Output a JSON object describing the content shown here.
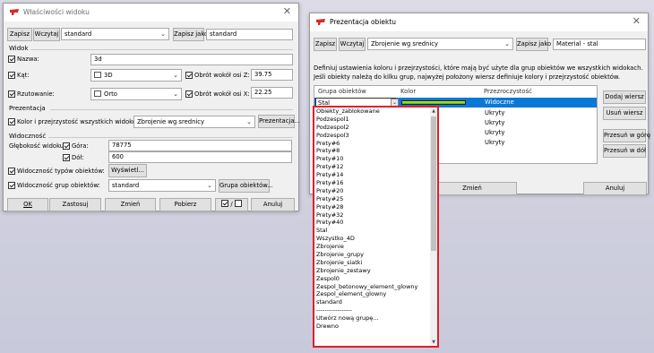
{
  "colors": {
    "brand_red": "#d42a2a",
    "selection": "#0a78d7",
    "highlight_border": "#e0202a"
  },
  "win1": {
    "title": "Właściwości widoku",
    "save_label": "Zapisz",
    "load_label": "Wczytaj",
    "preset_value": "standard",
    "save_as_label": "Zapisz jako",
    "save_as_value": "standard",
    "view_section": "Widok",
    "name_label": "Nazwa:",
    "name_value": "3d",
    "angle_label": "Kąt:",
    "angle_value": "3D",
    "rot_z_label": "Obrót wokół osi Z:",
    "rot_z_value": "39.75",
    "projection_label": "Rzutowanie:",
    "projection_value": "Orto",
    "rot_x_label": "Obrót wokół osi X:",
    "rot_x_value": "22.25",
    "presentation_section": "Prezentacja",
    "color_all_label": "Kolor i przejrzystość wszystkich widoków:",
    "color_all_value": "Zbrojenie wg srednicy",
    "presentation_button": "Prezentacja...",
    "visibility_section": "Widoczność",
    "depth_label": "Głębokość widoku:",
    "top_label": "Góra:",
    "top_value": "78775",
    "bottom_label": "Dół:",
    "bottom_value": "600",
    "type_vis_label": "Widoczność typów obiektów:",
    "show_button": "Wyświetl...",
    "group_vis_label": "Widoczność grup obiektów:",
    "group_vis_value": "standard",
    "group_button": "Grupa obiektów...",
    "ok": "OK",
    "apply": "Zastosuj",
    "modify": "Zmień",
    "get": "Pobierz",
    "toggle": "/",
    "cancel": "Anuluj"
  },
  "win2": {
    "title": "Prezentacja obiektu",
    "save_label": "Zapisz",
    "load_label": "Wczytaj",
    "preset_value": "Zbrojenie wg srednicy",
    "save_as_label": "Zapisz jako",
    "save_as_value": "Material - stal",
    "info_line1": "Definiuj ustawienia koloru i przejrzystości, które mają być użyte dla grup obiektów we wszystkich widokach.",
    "info_line2": "Jeśli obiekty należą do kilku grup, najwyżej położony wiersz definiuje kolory i przejrzystość obiektów.",
    "col_group": "Grupa obiektów",
    "col_color": "Kolor",
    "col_transparency": "Przezroczystość",
    "rows": [
      {
        "group": "Stal",
        "transparency": "Widoczne"
      },
      {
        "group": "",
        "transparency": "Ukryty"
      },
      {
        "group": "",
        "transparency": "Ukryty"
      },
      {
        "group": "",
        "transparency": "Ukryty"
      },
      {
        "group": "",
        "transparency": "Ukryty"
      }
    ],
    "add_row": "Dodaj wiersz",
    "delete_row": "Usuń wiersz",
    "move_up": "Przesuń w górę",
    "move_down": "Przesuń w dół",
    "modify": "Zmień",
    "cancel": "Anuluj"
  },
  "dropdown_items": [
    "Obiekty_zablokowane",
    "Podzespol1",
    "Podzespol2",
    "Podzespol3",
    "Prety#6",
    "Prety#8",
    "Prety#10",
    "Prety#12",
    "Prety#14",
    "Prety#16",
    "Prety#20",
    "Prety#25",
    "Prety#28",
    "Prety#32",
    "Prety#40",
    "Stal",
    "Wszystko_4D",
    "Zbrojenie",
    "Zbrojenie_grupy",
    "Zbrojenie_siatki",
    "Zbrojenie_zestawy",
    "Zespol0",
    "Zespol_betonowy_element_glowny",
    "Zespol_element_glowny",
    "standard",
    "-----------------",
    "Utwórz nową grupę...",
    "Drewno"
  ]
}
